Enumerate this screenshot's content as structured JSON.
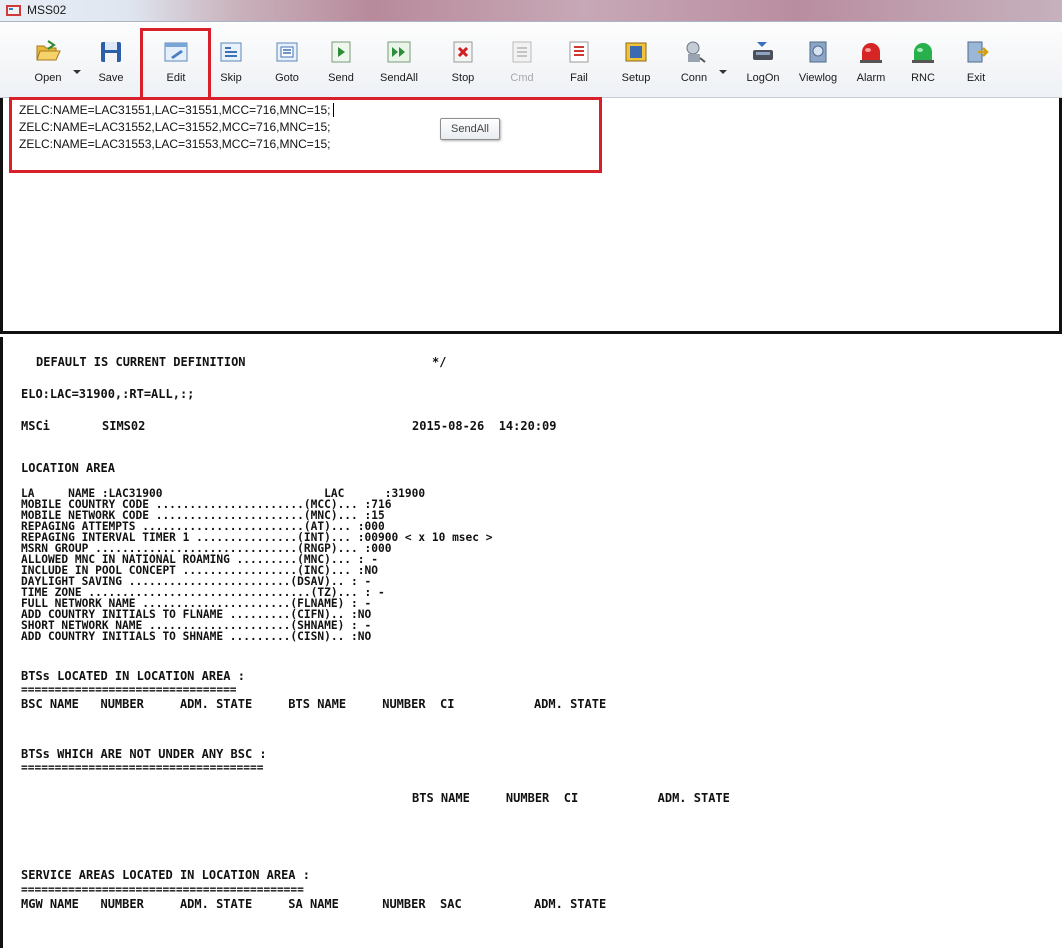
{
  "window": {
    "title": "MSS02"
  },
  "toolbar": {
    "buttons": [
      {
        "label": "Open",
        "icon": "open-folder-icon"
      },
      {
        "label": "Save",
        "icon": "floppy-disk-icon"
      },
      {
        "label": "Edit",
        "icon": "edit-document-icon"
      },
      {
        "label": "Skip",
        "icon": "skip-icon"
      },
      {
        "label": "Goto",
        "icon": "goto-icon"
      },
      {
        "label": "Send",
        "icon": "send-icon"
      },
      {
        "label": "SendAll",
        "icon": "send-all-icon"
      },
      {
        "label": "Stop",
        "icon": "stop-icon"
      },
      {
        "label": "Cmd",
        "icon": "command-icon",
        "disabled": true
      },
      {
        "label": "Fail",
        "icon": "fail-icon"
      },
      {
        "label": "Setup",
        "icon": "setup-icon"
      },
      {
        "label": "Conn",
        "icon": "connection-icon"
      },
      {
        "label": "LogOn",
        "icon": "logon-icon"
      },
      {
        "label": "Viewlog",
        "icon": "viewlog-icon"
      },
      {
        "label": "Alarm",
        "icon": "alarm-icon"
      },
      {
        "label": "RNC",
        "icon": "rnc-icon"
      },
      {
        "label": "Exit",
        "icon": "exit-icon"
      }
    ],
    "accent_red": "#d8202b"
  },
  "editor": {
    "lines": [
      "ZELC:NAME=LAC31551,LAC=31551,MCC=716,MNC=15;",
      "ZELC:NAME=LAC31552,LAC=31552,MCC=716,MNC=15;",
      "ZELC:NAME=LAC31553,LAC=31553,MCC=716,MNC=15;"
    ],
    "tooltip": "SendAll"
  },
  "output": {
    "header": "DEFAULT IS CURRENT DEFINITION",
    "header_mark": "*/",
    "command": "ELO:LAC=31900,:RT=ALL,:;",
    "node": "MSCi",
    "element": "SIMS02",
    "timestamp": "2015-08-26  14:20:09",
    "section_title": "LOCATION AREA",
    "params": [
      "LA     NAME :LAC31900                        LAC      :31900",
      "MOBILE COUNTRY CODE ......................(MCC)... :716",
      "MOBILE NETWORK CODE ......................(MNC)... :15",
      "REPAGING ATTEMPTS ........................(AT)... :000",
      "REPAGING INTERVAL TIMER 1 ...............(INT)... :00900 < x 10 msec >",
      "MSRN GROUP ..............................(RNGP)... :000",
      "ALLOWED MNC IN NATIONAL ROAMING .........(MNC)... : -",
      "INCLUDE IN POOL CONCEPT .................(INC)... :NO",
      "DAYLIGHT SAVING ........................(DSAV).. : -",
      "TIME ZONE .................................(TZ)... : -",
      "FULL NETWORK NAME ......................(FLNAME) : -",
      "ADD COUNTRY INITIALS TO FLNAME .........(CIFN).. :NO",
      "SHORT NETWORK NAME .....................(SHNAME) : -",
      "ADD COUNTRY INITIALS TO SHNAME .........(CISN).. :NO"
    ],
    "bts_section": {
      "title": "BTSs LOCATED IN LOCATION AREA :",
      "rule": "================================",
      "columns": "BSC NAME   NUMBER     ADM. STATE     BTS NAME     NUMBER  CI           ADM. STATE"
    },
    "bts_no_bsc_section": {
      "title": "BTSs WHICH ARE NOT UNDER ANY BSC :",
      "rule": "====================================",
      "columns": "BTS NAME     NUMBER  CI           ADM. STATE"
    },
    "sa_section": {
      "title": "SERVICE AREAS LOCATED IN LOCATION AREA :",
      "rule": "==========================================",
      "columns": "MGW NAME   NUMBER     ADM. STATE     SA NAME      NUMBER  SAC          ADM. STATE"
    }
  }
}
